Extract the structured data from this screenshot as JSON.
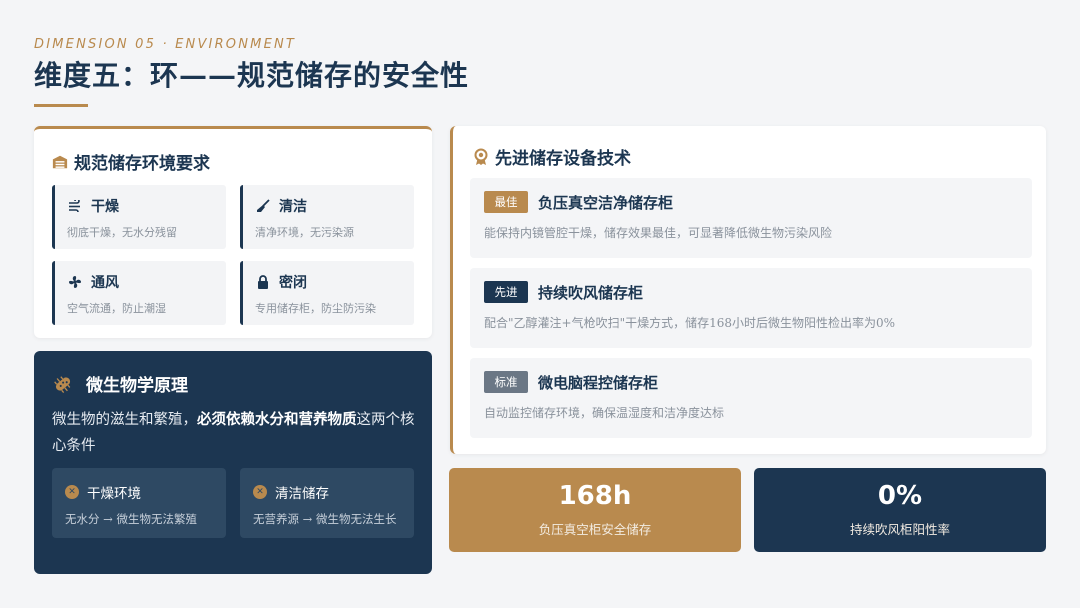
{
  "header": {
    "subtitle": "DIMENSION 05 · ENVIRONMENT",
    "title": "维度五：环——规范储存的安全性"
  },
  "env_card": {
    "title": "规范储存环境要求",
    "icon": "warehouse-icon",
    "items": [
      {
        "icon": "wind-icon",
        "label": "干燥",
        "desc": "彻底干燥，无水分残留"
      },
      {
        "icon": "broom-icon",
        "label": "清洁",
        "desc": "清净环境，无污染源"
      },
      {
        "icon": "fan-icon",
        "label": "通风",
        "desc": "空气流通，防止潮湿"
      },
      {
        "icon": "lock-icon",
        "label": "密闭",
        "desc": "专用储存柜，防尘防污染"
      }
    ]
  },
  "micro_card": {
    "title": "微生物学原理",
    "icon": "bacteria-icon",
    "text_pre": "微生物的滋生和繁殖，",
    "text_bold": "必须依赖水分和营养物质",
    "text_post": "这两个核心条件",
    "boxes": [
      {
        "icon": "x-circle-icon",
        "label": "干燥环境",
        "desc": "无水分 → 微生物无法繁殖"
      },
      {
        "icon": "x-circle-icon",
        "label": "清洁储存",
        "desc": "无营养源 → 微生物无法生长"
      }
    ]
  },
  "tech_card": {
    "title": "先进储存设备技术",
    "icon": "award-icon",
    "items": [
      {
        "badge": "最佳",
        "badge_color": "#b98a4e",
        "label": "负压真空洁净储存柜",
        "desc": "能保持内镜管腔干燥，储存效果最佳，可显著降低微生物污染风险"
      },
      {
        "badge": "先进",
        "badge_color": "#1c3651",
        "label": "持续吹风储存柜",
        "desc": "配合\"乙醇灌注+气枪吹扫\"干燥方式，储存168小时后微生物阳性检出率为0%"
      },
      {
        "badge": "标准",
        "badge_color": "#6b7785",
        "label": "微电脑程控储存柜",
        "desc": "自动监控储存环境，确保温湿度和洁净度达标"
      }
    ]
  },
  "stats": [
    {
      "value": "168h",
      "label": "负压真空柜安全储存",
      "color": "#b98a4e"
    },
    {
      "value": "0%",
      "label": "持续吹风柜阳性率",
      "color": "#1c3651"
    }
  ]
}
